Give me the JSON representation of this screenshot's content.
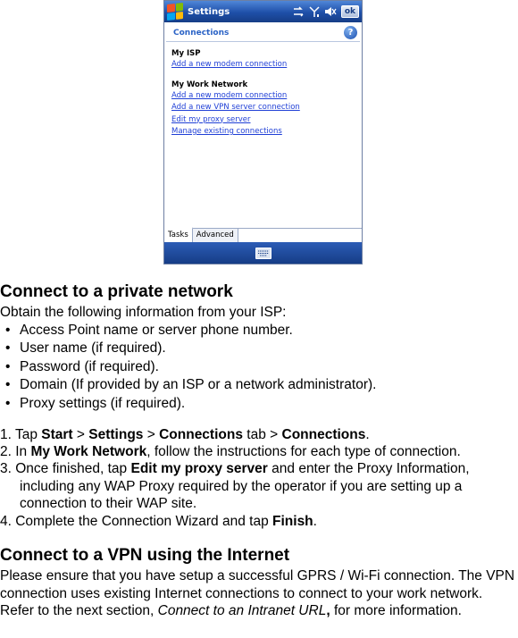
{
  "device": {
    "title": "Settings",
    "ok_label": "ok",
    "page_heading": "Connections",
    "help_glyph": "?",
    "groups": [
      {
        "name": "My ISP",
        "links": [
          "Add a new modem connection"
        ]
      },
      {
        "name": "My Work Network",
        "links": [
          "Add a new modem connection",
          "Add a new VPN server connection",
          "Edit my proxy server",
          "Manage existing connections"
        ]
      }
    ],
    "tabs": [
      "Tasks",
      "Advanced"
    ],
    "colors": {
      "titlebar": "#1e4fa8",
      "link": "#1f3fd6",
      "heading": "#2b63c6"
    }
  },
  "doc": {
    "section1_title": "Connect to a private network",
    "intro": "Obtain the following information from your ISP:",
    "bullets": [
      "Access Point name or server phone number.",
      "User name (if required).",
      "Password (if required).",
      "Domain (If provided by an ISP or a network administrator).",
      "Proxy settings (if required)."
    ],
    "steps": {
      "s1": {
        "num": "1. Tap ",
        "start": "Start",
        "sep1": " > ",
        "settings": "Settings",
        "sep2": " > ",
        "connections_tab": "Connections",
        "tab_word": " tab > ",
        "connections": "Connections",
        "end": "."
      },
      "s2": {
        "num": "2. In ",
        "bold": "My Work Network",
        "rest": ", follow the instructions for each type of connection."
      },
      "s3": {
        "num": "3. Once finished, tap ",
        "bold": "Edit my proxy server",
        "rest": " and enter the Proxy Information, including any WAP Proxy required by the operator if you are setting up a connection to their WAP site."
      },
      "s4": {
        "num": "4. Complete the Connection Wizard and tap ",
        "bold": "Finish",
        "rest": "."
      }
    },
    "section2_title": "Connect to a VPN using the Internet",
    "para2_before": "Please ensure that you have setup a successful GPRS / Wi-Fi connection. The VPN connection uses existing Internet connections to connect to your work network. Refer to the next section, ",
    "para2_italic": "Connect to an Intranet URL",
    "para2_bold": ",",
    "para2_after": " for more information."
  }
}
